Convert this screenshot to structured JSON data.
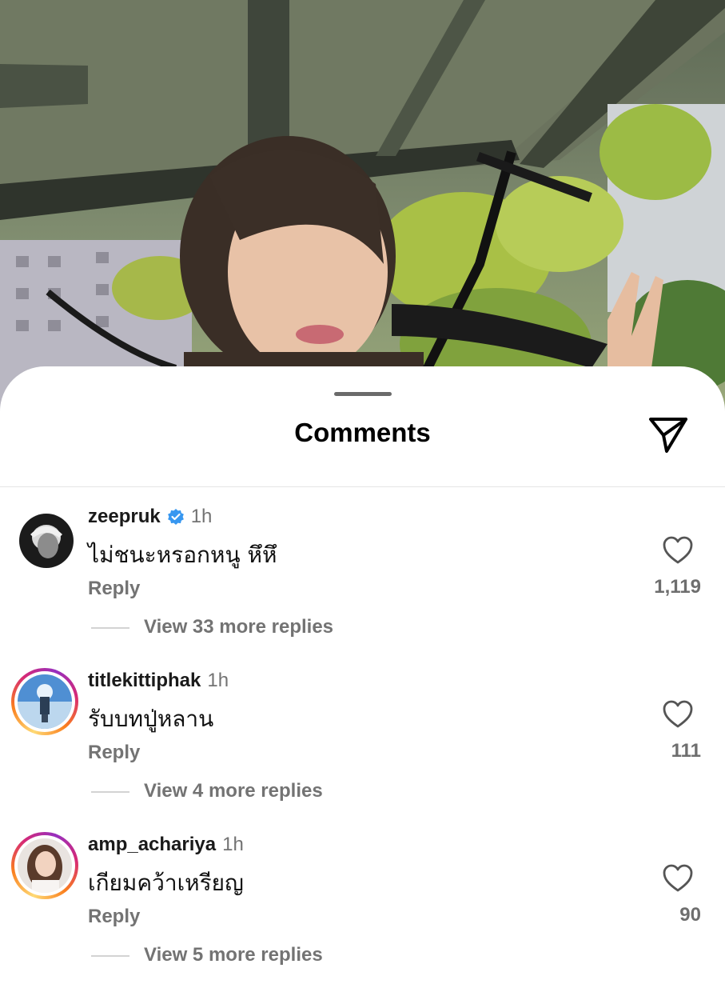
{
  "sheet": {
    "title": "Comments"
  },
  "comments": [
    {
      "username": "zeepruk",
      "verified": true,
      "time": "1h",
      "text": "ไม่ชนะหรอกหนู หึหึ",
      "reply_label": "Reply",
      "likes": "1,119",
      "view_more": "View 33 more replies",
      "story_ring": false
    },
    {
      "username": "titlekittiphak",
      "verified": false,
      "time": "1h",
      "text": "รับบทปู่หลาน",
      "reply_label": "Reply",
      "likes": "111",
      "view_more": "View 4 more replies",
      "story_ring": true
    },
    {
      "username": "amp_achariya",
      "verified": false,
      "time": "1h",
      "text": "เกียมคว้าเหรียญ",
      "reply_label": "Reply",
      "likes": "90",
      "view_more": "View 5 more replies",
      "story_ring": true
    }
  ],
  "colors": {
    "verified_badge": "#3797f0",
    "muted_text": "#737373"
  },
  "icons": {
    "share": "paper-plane-icon",
    "like": "heart-outline-icon",
    "verified": "verified-badge-icon"
  }
}
